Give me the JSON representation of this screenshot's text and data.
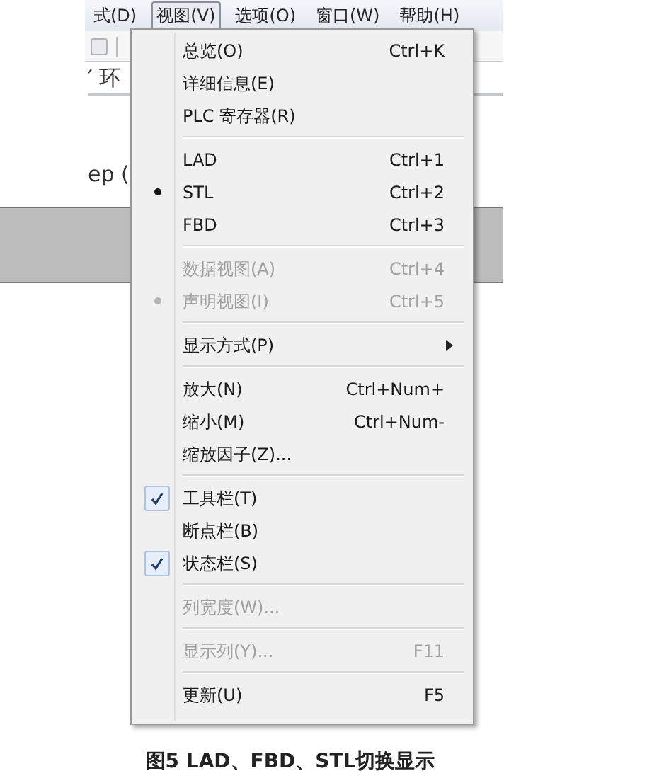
{
  "menubar": [
    {
      "label": "式(D)",
      "selected": false
    },
    {
      "label": "视图(V)",
      "selected": true
    },
    {
      "label": "选项(O)",
      "selected": false
    },
    {
      "label": "窗口(W)",
      "selected": false
    },
    {
      "label": "帮助(H)",
      "selected": false
    }
  ],
  "background_texts": [
    "′ 环",
    "ep ("
  ],
  "menu": [
    {
      "kind": "plain",
      "label": "总览(O)",
      "shortcut": "Ctrl+K",
      "disabled": false
    },
    {
      "kind": "plain",
      "label": "详细信息(E)",
      "disabled": false
    },
    {
      "kind": "plain",
      "label": "PLC 寄存器(R)",
      "disabled": false
    },
    {
      "kind": "separator"
    },
    {
      "kind": "radio",
      "label": "LAD",
      "shortcut": "Ctrl+1",
      "disabled": false,
      "selected": false
    },
    {
      "kind": "radio",
      "label": "STL",
      "shortcut": "Ctrl+2",
      "disabled": false,
      "selected": true
    },
    {
      "kind": "radio",
      "label": "FBD",
      "shortcut": "Ctrl+3",
      "disabled": false,
      "selected": false
    },
    {
      "kind": "separator"
    },
    {
      "kind": "radio",
      "label": "数据视图(A)",
      "shortcut": "Ctrl+4",
      "disabled": true,
      "selected": false
    },
    {
      "kind": "radio",
      "label": "声明视图(I)",
      "shortcut": "Ctrl+5",
      "disabled": true,
      "selected": true
    },
    {
      "kind": "separator"
    },
    {
      "kind": "submenu",
      "label": "显示方式(P)",
      "disabled": false
    },
    {
      "kind": "separator"
    },
    {
      "kind": "plain",
      "label": "放大(N)",
      "shortcut": "Ctrl+Num+",
      "disabled": false
    },
    {
      "kind": "plain",
      "label": "缩小(M)",
      "shortcut": "Ctrl+Num-",
      "disabled": false
    },
    {
      "kind": "plain",
      "label": "缩放因子(Z)...",
      "disabled": false
    },
    {
      "kind": "separator"
    },
    {
      "kind": "check",
      "label": "工具栏(T)",
      "disabled": false,
      "checked": true
    },
    {
      "kind": "check",
      "label": "断点栏(B)",
      "disabled": false,
      "checked": false
    },
    {
      "kind": "check",
      "label": "状态栏(S)",
      "disabled": false,
      "checked": true
    },
    {
      "kind": "separator"
    },
    {
      "kind": "plain",
      "label": "列宽度(W)...",
      "disabled": true
    },
    {
      "kind": "separator"
    },
    {
      "kind": "plain",
      "label": "显示列(Y)...",
      "shortcut": "F11",
      "disabled": true
    },
    {
      "kind": "separator"
    },
    {
      "kind": "plain",
      "label": "更新(U)",
      "shortcut": "F5",
      "disabled": false
    }
  ],
  "caption": "图5 LAD、FBD、STL切换显示"
}
